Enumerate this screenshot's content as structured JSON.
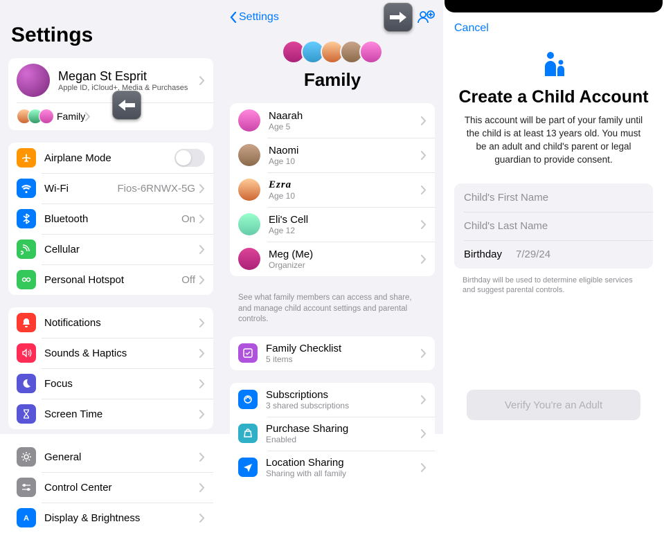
{
  "pane1": {
    "title": "Settings",
    "profile": {
      "name": "Megan St Esprit",
      "sub": "Apple ID, iCloud+, Media & Purchases"
    },
    "family_label": "Family",
    "airplane": "Airplane Mode",
    "wifi": {
      "label": "Wi-Fi",
      "value": "Fios-6RNWX-5G"
    },
    "bluetooth": {
      "label": "Bluetooth",
      "value": "On"
    },
    "cellular": "Cellular",
    "hotspot": {
      "label": "Personal Hotspot",
      "value": "Off"
    },
    "notifications": "Notifications",
    "sounds": "Sounds & Haptics",
    "focus": "Focus",
    "screentime": "Screen Time",
    "general": "General",
    "controlcenter": "Control Center",
    "display": "Display & Brightness"
  },
  "pane2": {
    "back": "Settings",
    "title": "Family",
    "members": [
      {
        "name": "Naarah",
        "sub": "Age 5"
      },
      {
        "name": "Naomi",
        "sub": "Age 10"
      },
      {
        "name": "Ezra",
        "sub": "Age 10"
      },
      {
        "name": "Eli's Cell",
        "sub": "Age 12"
      },
      {
        "name": "Meg (Me)",
        "sub": "Organizer"
      }
    ],
    "footnote": "See what family members can access and share, and manage child account settings and parental controls.",
    "checklist": {
      "label": "Family Checklist",
      "sub": "5 items"
    },
    "subs": {
      "label": "Subscriptions",
      "sub": "3 shared subscriptions"
    },
    "purchase": {
      "label": "Purchase Sharing",
      "sub": "Enabled"
    },
    "location": {
      "label": "Location Sharing",
      "sub": "Sharing with all family"
    }
  },
  "pane3": {
    "cancel": "Cancel",
    "title": "Create a Child Account",
    "desc": "This account will be part of your family until the child is at least 13 years old. You must be an adult and child's parent or legal guardian to provide consent.",
    "first_ph": "Child's First Name",
    "last_ph": "Child's Last Name",
    "birthday_label": "Birthday",
    "birthday_value": "7/29/24",
    "form_note": "Birthday will be used to determine eligible services and suggest parental controls.",
    "verify": "Verify You're an Adult"
  }
}
